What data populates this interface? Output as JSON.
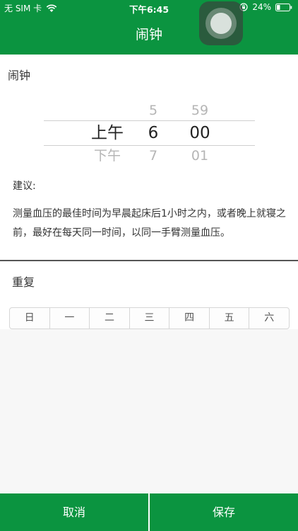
{
  "status_bar": {
    "carrier": "无 SIM 卡",
    "time": "下午6:45",
    "battery": "24%"
  },
  "nav": {
    "title": "闹钟"
  },
  "alarm_section": {
    "label": "闹钟"
  },
  "picker": {
    "above": {
      "ampm": "",
      "hour": "5",
      "minute": "59"
    },
    "selected": {
      "ampm": "上午",
      "hour": "6",
      "minute": "00"
    },
    "below": {
      "ampm": "下午",
      "hour": "7",
      "minute": "01"
    }
  },
  "advice": {
    "title": "建议:",
    "text": "测量血压的最佳时间为早晨起床后1小时之内，或者晚上就寝之前，最好在每天同一时间，以同一手臂测量血压。"
  },
  "repeat": {
    "label": "重复",
    "days": [
      "日",
      "一",
      "二",
      "三",
      "四",
      "五",
      "六"
    ]
  },
  "footer": {
    "cancel_label": "取消",
    "save_label": "保存"
  },
  "colors": {
    "brand_green": "#0b9440"
  },
  "icons": [
    "wifi-icon",
    "lock-rotation-icon",
    "battery-icon",
    "assistive-touch-icon"
  ]
}
